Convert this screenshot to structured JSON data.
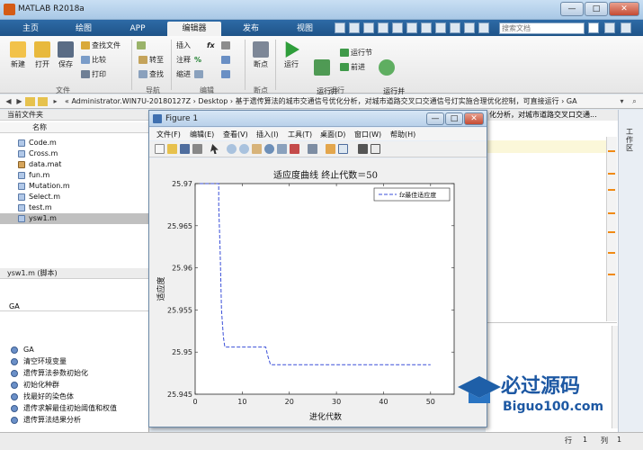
{
  "window": {
    "title": "MATLAB R2018a",
    "minimize": "—",
    "maximize": "□",
    "close": "✕"
  },
  "tabs": [
    {
      "label": "主页"
    },
    {
      "label": "绘图"
    },
    {
      "label": "APP"
    },
    {
      "label": "编辑器"
    },
    {
      "label": "发布"
    },
    {
      "label": "视图"
    }
  ],
  "search": {
    "placeholder": "搜索文档"
  },
  "ribbon": {
    "file": {
      "new": "新建",
      "open": "打开",
      "save": "保存",
      "find_files": "查找文件",
      "compare": "比较",
      "print": "打印",
      "group": "文件"
    },
    "nav": {
      "goto": "转至",
      "find": "查找",
      "group": "导航"
    },
    "edit": {
      "insert": "插入",
      "fx": "fx",
      "comment": "注释",
      "pct": "%",
      "indent": "缩进",
      "group": "编辑"
    },
    "breakpoints": {
      "label": "断点",
      "group": "断点"
    },
    "run": {
      "run": "运行",
      "run_advance": "运行并\n前进",
      "run_section": "运行节",
      "advance": "前进",
      "run_time": "运行并\n计时",
      "group": "运行"
    }
  },
  "address": {
    "path": "« Administrator.WIN7U-20180127Z  ›  Desktop  ›  基于遗传算法的城市交通信号优化分析，对城市道路交叉口交通信号灯实施合理优化控制，可直接运行  ›  GA"
  },
  "left": {
    "current_folder": "当前文件夹",
    "name_header": "名称",
    "files": [
      "Code.m",
      "Cross.m",
      "data.mat",
      "fun.m",
      "Mutation.m",
      "Select.m",
      "test.m",
      "ysw1.m"
    ],
    "selected": "ysw1.m",
    "details_header": "ysw1.m  (脚本)",
    "func_root": "GA",
    "functions": [
      "GA",
      "清空环境变量",
      "遗传算法参数初始化",
      "初始化种群",
      "找最好的染色体",
      "遗传求解最佳初始阈值和权值",
      "遗传算法结果分析"
    ]
  },
  "right": {
    "panel_label": "工作区",
    "crumb": "化分析，对城市道路交叉口交通..."
  },
  "figure": {
    "title": "Figure 1",
    "menus": [
      "文件(F)",
      "编辑(E)",
      "查看(V)",
      "插入(I)",
      "工具(T)",
      "桌面(D)",
      "窗口(W)",
      "帮助(H)"
    ]
  },
  "chart_data": {
    "type": "line",
    "title": "适应度曲线  终止代数＝50",
    "xlabel": "进化代数",
    "ylabel": "适应度",
    "xlim": [
      0,
      55
    ],
    "ylim": [
      25.945,
      25.97
    ],
    "xticks": [
      0,
      10,
      20,
      30,
      40,
      50
    ],
    "xtick_labels": [
      "0",
      "10",
      "20",
      "30",
      "40",
      "50"
    ],
    "yticks": [
      25.945,
      25.95,
      25.955,
      25.96,
      25.965,
      25.97
    ],
    "ytick_labels": [
      "25.945",
      "25.95",
      "25.955",
      "25.96",
      "25.965",
      "25.97"
    ],
    "legend": "fz最佳适应度",
    "legend_position": "top-right",
    "series": [
      {
        "name": "fz最佳适应度",
        "color": "#3a4fd8",
        "style": "dashed",
        "x": [
          1,
          5,
          5,
          5.3,
          5.6,
          6,
          6.3,
          15,
          15.4,
          16,
          50
        ],
        "y": [
          25.97,
          25.97,
          25.9675,
          25.962,
          25.955,
          25.9518,
          25.9506,
          25.9506,
          25.9496,
          25.9485,
          25.9485
        ]
      }
    ]
  },
  "status": {
    "row_label": "行",
    "row": "1",
    "col_label": "列",
    "col": "1"
  },
  "watermark": {
    "brand": "必过源码",
    "url": "Biguo100.com"
  }
}
